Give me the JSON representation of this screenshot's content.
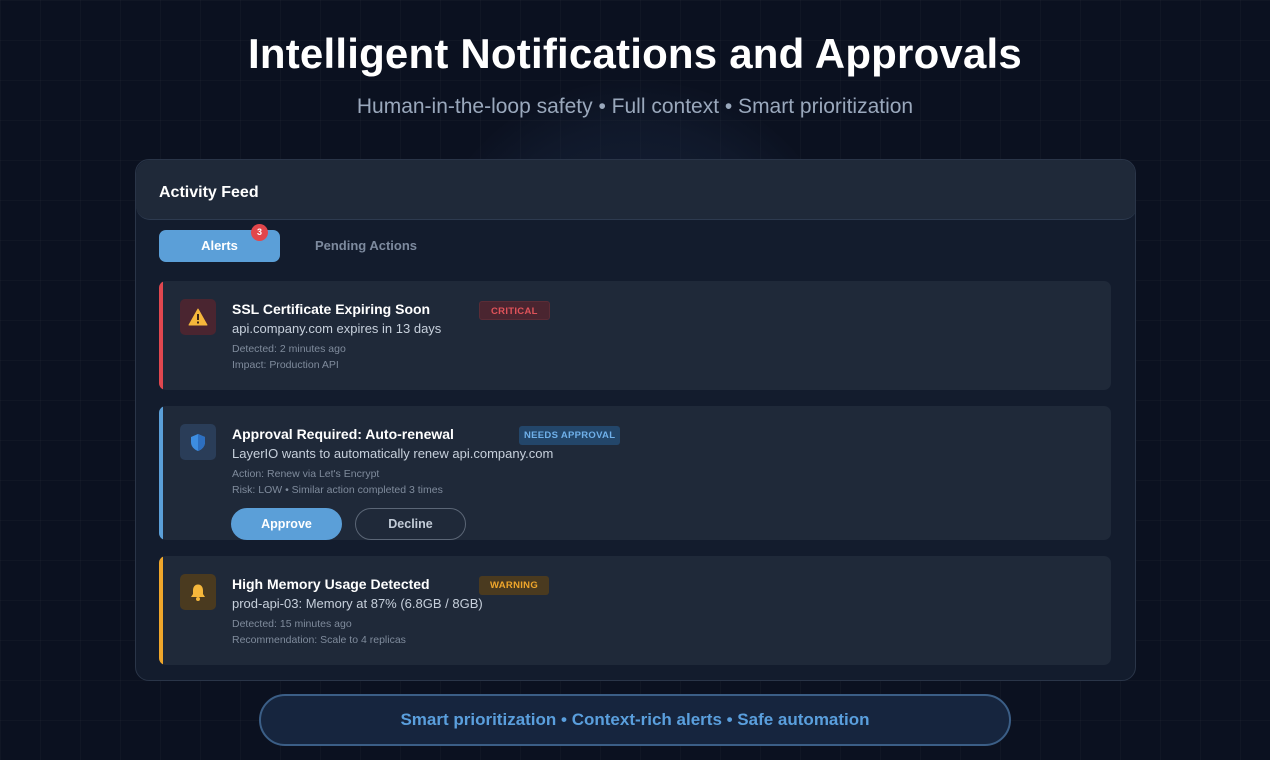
{
  "hero": {
    "title": "Intelligent Notifications and Approvals",
    "subtitle": "Human-in-the-loop safety • Full context • Smart prioritization"
  },
  "feed": {
    "title": "Activity Feed",
    "tabs": [
      {
        "label": "Alerts",
        "badge": "3",
        "active": true
      },
      {
        "label": "Pending Actions",
        "active": false
      }
    ],
    "cards": [
      {
        "title": "SSL Certificate Expiring Soon",
        "description": "api.company.com expires in 13 days",
        "badge": "CRITICAL",
        "meta": [
          "Detected: 2 minutes ago",
          "Impact: Production API"
        ],
        "icon": "warning-icon",
        "accent": "#e0474f"
      },
      {
        "title": "Approval Required: Auto-renewal",
        "description": "LayerIO wants to automatically renew api.company.com",
        "badge": "NEEDS APPROVAL",
        "meta": [
          "Action: Renew via Let's Encrypt",
          "Risk: LOW • Similar action completed 3 times"
        ],
        "icon": "shield-icon",
        "accent": "#5b9fd8",
        "actions": {
          "approve": "Approve",
          "decline": "Decline"
        }
      },
      {
        "title": "High Memory Usage Detected",
        "description": "prod-api-03: Memory at 87% (6.8GB / 8GB)",
        "badge": "WARNING",
        "meta": [
          "Detected: 15 minutes ago",
          "Recommendation: Scale to 4 replicas"
        ],
        "icon": "bell-icon",
        "accent": "#efa62b"
      }
    ]
  },
  "footer": {
    "tagline": "Smart prioritization • Context-rich alerts • Safe automation"
  },
  "colors": {
    "background": "#0b1120",
    "panel": "#131c2d",
    "card": "#1f2939",
    "accent_blue": "#5b9fd8",
    "critical": "#e0474f",
    "warning": "#efa62b"
  }
}
